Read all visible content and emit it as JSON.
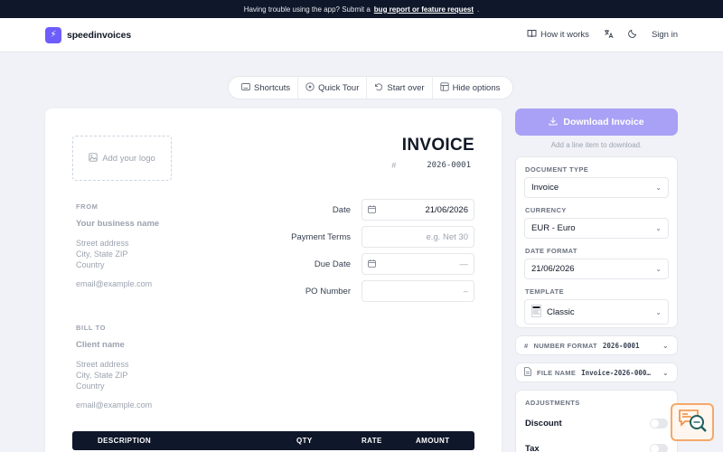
{
  "banner": {
    "text": "Having trouble using the app? Submit a",
    "link": "bug report or feature request",
    "suffix": "."
  },
  "header": {
    "brand": "speedinvoices",
    "nav": {
      "how_it_works": "How it works",
      "sign_in": "Sign in"
    }
  },
  "toolbar": {
    "shortcuts": "Shortcuts",
    "quick_tour": "Quick Tour",
    "start_over": "Start over",
    "hide_options": "Hide options"
  },
  "invoice": {
    "logo_placeholder": "Add your logo",
    "title": "INVOICE",
    "number_prefix": "#",
    "number": "2026-0001",
    "from": {
      "label": "FROM",
      "name": "Your business name",
      "address": [
        "Street address",
        "City, State ZIP",
        "Country"
      ],
      "email": "email@example.com"
    },
    "bill_to": {
      "label": "BILL TO",
      "name": "Client name",
      "address": [
        "Street address",
        "City, State ZIP",
        "Country"
      ],
      "email": "email@example.com"
    },
    "fields": {
      "date_label": "Date",
      "date_value": "21/06/2026",
      "terms_label": "Payment Terms",
      "terms_placeholder": "e.g. Net 30",
      "due_label": "Due Date",
      "due_value": "—",
      "po_label": "PO Number",
      "po_value": "–"
    },
    "table_headers": {
      "description": "DESCRIPTION",
      "qty": "QTY",
      "rate": "RATE",
      "amount": "AMOUNT"
    }
  },
  "sidebar": {
    "download_label": "Download Invoice",
    "download_hint": "Add a line item to download.",
    "document_type": {
      "label": "DOCUMENT TYPE",
      "value": "Invoice"
    },
    "currency": {
      "label": "CURRENCY",
      "value": "EUR - Euro"
    },
    "date_format": {
      "label": "DATE FORMAT",
      "value": "21/06/2026"
    },
    "template": {
      "label": "TEMPLATE",
      "value": "Classic"
    },
    "number_format": {
      "label": "NUMBER FORMAT",
      "value": "2026-0001"
    },
    "file_name": {
      "label": "FILE NAME",
      "value": "Invoice-2026-0001..."
    },
    "adjustments": {
      "label": "ADJUSTMENTS",
      "discount": "Discount",
      "tax": "Tax"
    }
  },
  "colors": {
    "accent": "#6d5dfc",
    "download_button": "#a9a1f5",
    "dark_header": "#0f172a"
  }
}
